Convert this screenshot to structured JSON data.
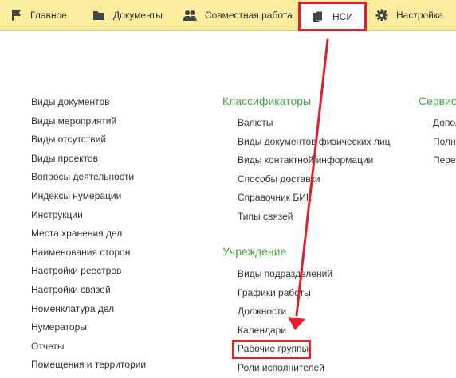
{
  "tabs": [
    {
      "label": "Главное",
      "icon": "flag-icon"
    },
    {
      "label": "Документы",
      "icon": "folder-icon"
    },
    {
      "label": "Совместная работа",
      "icon": "users-icon"
    },
    {
      "label": "НСИ",
      "icon": "books-icon",
      "active": true
    },
    {
      "label": "Настройка",
      "icon": "gear-icon"
    }
  ],
  "left_list": [
    "Виды документов",
    "Виды мероприятий",
    "Виды отсутствий",
    "Виды проектов",
    "Вопросы деятельности",
    "Индексы нумерации",
    "Инструкции",
    "Места хранения дел",
    "Наименования сторон",
    "Настройки реестров",
    "Настройки связей",
    "Номенклатура дел",
    "Нумераторы",
    "Отчеты",
    "Помещения и территории"
  ],
  "classifiers": {
    "title": "Классификаторы",
    "items": [
      "Валюты",
      "Виды документов физических лиц",
      "Виды контактной информации",
      "Способы доставки",
      "Справочник БИК",
      "Типы связей"
    ]
  },
  "institution": {
    "title": "Учреждение",
    "items": [
      "Виды подразделений",
      "Графики работы",
      "Должности",
      "Календари",
      "Рабочие группы",
      "Роли исполнителей"
    ]
  },
  "service": {
    "title": "Сервис",
    "items": [
      "Допол",
      "Полн",
      "Пере"
    ]
  },
  "colors": {
    "topbar": "#fbed9e",
    "group_title": "#4aa34a",
    "highlight": "#e0212d"
  }
}
